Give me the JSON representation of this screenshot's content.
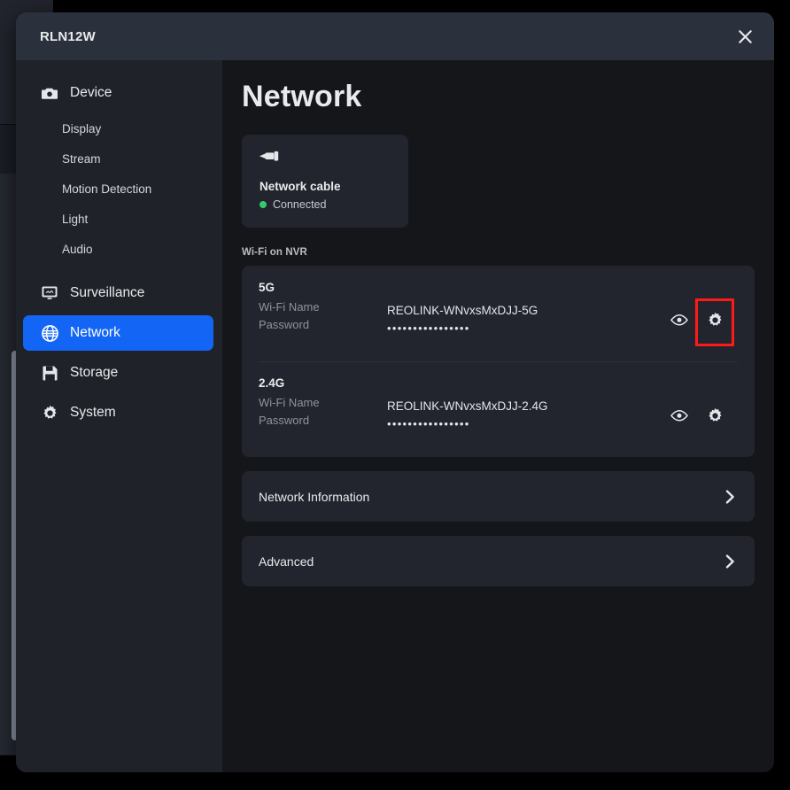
{
  "window": {
    "title": "RLN12W",
    "close_label": "×",
    "close_icon": "close-icon"
  },
  "sidebar": {
    "groups": [
      {
        "label": "Device",
        "icon": "camera-icon",
        "active": false,
        "children": [
          "Display",
          "Stream",
          "Motion Detection",
          "Light",
          "Audio"
        ]
      }
    ],
    "items": [
      {
        "label": "Surveillance",
        "icon": "monitor-icon",
        "active": false
      },
      {
        "label": "Network",
        "icon": "globe-icon",
        "active": true
      },
      {
        "label": "Storage",
        "icon": "disk-icon",
        "active": false
      },
      {
        "label": "System",
        "icon": "gear-icon",
        "active": false
      }
    ],
    "active_accent": "#1366f5"
  },
  "main": {
    "page_title": "Network",
    "cable_card": {
      "icon": "ethernet-cable-icon",
      "title": "Network cable",
      "status": "Connected",
      "status_color": "#33cc6c"
    },
    "wifi_section_label": "Wi-Fi on NVR",
    "wifi_rows": [
      {
        "band": "5G",
        "name_label": "Wi-Fi Name",
        "name_value": "REOLINK-WNvxsMxDJJ-5G",
        "password_label": "Password",
        "password_value": "••••••••••••••••",
        "eye_icon": "eye-icon",
        "gear_icon": "gear-icon",
        "gear_highlighted": true
      },
      {
        "band": "2.4G",
        "name_label": "Wi-Fi Name",
        "name_value": "REOLINK-WNvxsMxDJJ-2.4G",
        "password_label": "Password",
        "password_value": "••••••••••••••••",
        "eye_icon": "eye-icon",
        "gear_icon": "gear-icon",
        "gear_highlighted": false
      }
    ],
    "link_cards": [
      {
        "label": "Network Information",
        "chevron": "chevron-right-icon"
      },
      {
        "label": "Advanced",
        "chevron": "chevron-right-icon"
      }
    ]
  },
  "highlight": {
    "color": "#ff1a1a",
    "target": "gear-icon-5g"
  }
}
